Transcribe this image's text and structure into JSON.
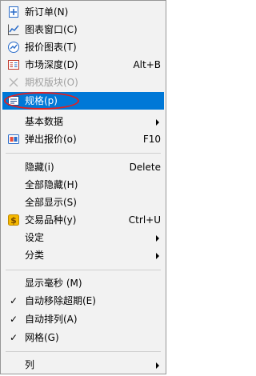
{
  "menu": {
    "items": [
      {
        "label": "新订单(N)",
        "icon": "new-order-icon"
      },
      {
        "label": "图表窗口(C)",
        "icon": "line-chart-icon"
      },
      {
        "label": "报价图表(T)",
        "icon": "quote-chart-icon"
      },
      {
        "label": "市场深度(D)",
        "shortcut": "Alt+B",
        "icon": "market-depth-icon"
      },
      {
        "label": "期权版块(O)",
        "icon": "options-icon",
        "disabled": true
      },
      {
        "label": "规格(p)",
        "icon": "specification-icon",
        "selected": true
      },
      {
        "label": "基本数据",
        "submenu": true
      },
      {
        "label": "弹出报价(o)",
        "shortcut": "F10",
        "icon": "popup-quote-icon"
      },
      {
        "label": "隐藏(i)",
        "shortcut": "Delete"
      },
      {
        "label": "全部隐藏(H)"
      },
      {
        "label": "全部显示(S)"
      },
      {
        "label": "交易品种(y)",
        "shortcut": "Ctrl+U",
        "icon": "dollar-icon"
      },
      {
        "label": "设定",
        "submenu": true
      },
      {
        "label": "分类",
        "submenu": true
      },
      {
        "label": "显示毫秒 (M)"
      },
      {
        "label": "自动移除超期(E)",
        "checked": true
      },
      {
        "label": "自动排列(A)",
        "checked": true
      },
      {
        "label": "网格(G)",
        "checked": true
      },
      {
        "label": "列",
        "submenu": true
      }
    ]
  },
  "colors": {
    "highlight": "#0078d7",
    "annotation": "#e02020",
    "disabled": "#a0a0a0"
  }
}
